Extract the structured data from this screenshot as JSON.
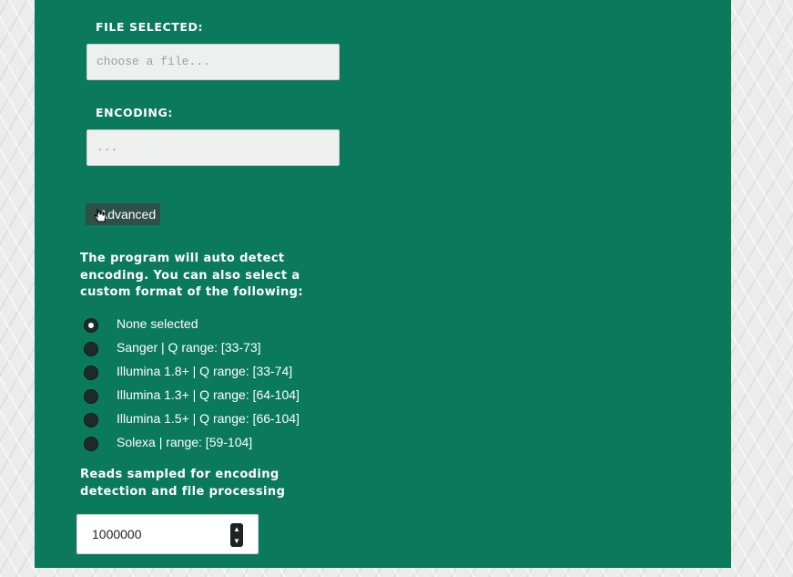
{
  "file_section": {
    "label": "FILE SELECTED:",
    "placeholder": "choose a file..."
  },
  "encoding_section": {
    "label": "ENCODING:",
    "placeholder": "..."
  },
  "advanced_button": {
    "label": "Advanced"
  },
  "description": "The program will auto detect encoding. You can also select a custom format of the following:",
  "formats": {
    "items": [
      {
        "label": "None selected",
        "checked": true
      },
      {
        "label": "Sanger | Q range: [33-73]",
        "checked": false
      },
      {
        "label": "Illumina 1.8+ | Q range: [33-74]",
        "checked": false
      },
      {
        "label": "Illumina 1.3+ | Q range: [64-104]",
        "checked": false
      },
      {
        "label": "Illumina 1.5+ | Q range: [66-104]",
        "checked": false
      },
      {
        "label": "Solexa | range: [59-104]",
        "checked": false
      }
    ]
  },
  "reads_section": {
    "label": "Reads sampled for encoding detection and file processing",
    "value": "1000000"
  },
  "colors": {
    "panel": "#0b7a5c",
    "button": "#2f4f47",
    "field_bg": "#edf0ee"
  }
}
